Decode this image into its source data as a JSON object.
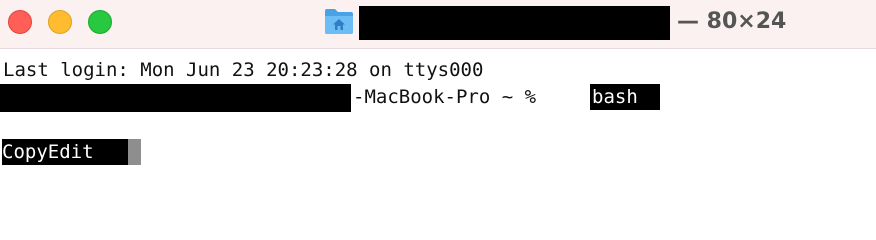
{
  "window": {
    "title_suffix": "— 80×24",
    "icon": "home-folder-icon"
  },
  "terminal": {
    "last_login": "Last login: Mon Jun 23 20:23:28 on ttys000",
    "prompt_host_suffix": "-MacBook-Pro ~ % ",
    "command": "bash",
    "output_selected": "CopyEdit"
  },
  "colors": {
    "titlebar_bg": "#fbf1f1",
    "close": "#ff5f57",
    "minimize": "#febc2e",
    "zoom": "#28c840",
    "folder_blue": "#5ab0ec",
    "cursor": "#8e8e8e",
    "redaction": "#000000"
  }
}
